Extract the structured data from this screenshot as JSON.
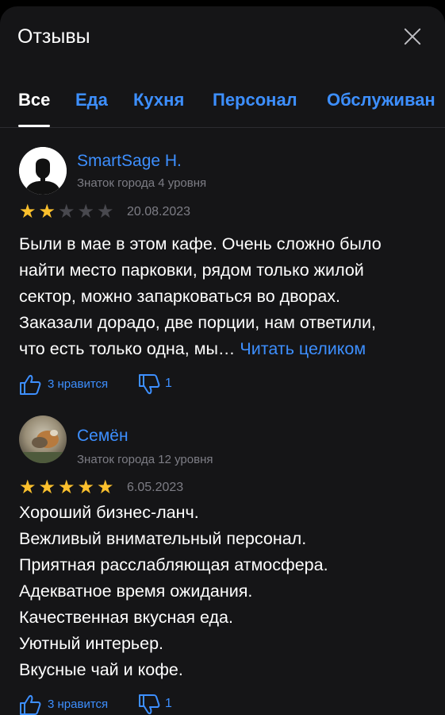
{
  "header": {
    "title": "Отзывы",
    "close_icon": "close-icon"
  },
  "tabs": [
    {
      "label": "Все",
      "active": true
    },
    {
      "label": "Еда",
      "active": false
    },
    {
      "label": "Кухня",
      "active": false
    },
    {
      "label": "Персонал",
      "active": false
    },
    {
      "label": "Обслуживан",
      "active": false
    }
  ],
  "colors": {
    "accent": "#3d8fff",
    "star": "#fbc02d",
    "background": "#151517"
  },
  "reviews": [
    {
      "author": "SmartSage H.",
      "level": "Знаток города 4 уровня",
      "rating": 2,
      "rating_max": 5,
      "date": "20.08.2023",
      "lines": [
        "Были в мае в этом кафе. Очень сложно было",
        "найти место парковки, рядом только жилой",
        "сектор, можно запарковаться во дворах.",
        "Заказали дорадо, две порции, нам ответили,",
        "что есть только одна, мы…"
      ],
      "read_more": "Читать целиком",
      "like_label": "3 нравится",
      "dislike_count": "1",
      "avatar_icon": "user-silhouette-icon"
    },
    {
      "author": "Семён",
      "level": "Знаток города 12 уровня",
      "rating": 5,
      "rating_max": 5,
      "date": "6.05.2023",
      "lines": [
        "Хороший бизнес-ланч.",
        "Вежливый внимательный персонал.",
        "Приятная расслабляющая атмосфера.",
        "Адекватное время ожидания.",
        "Качественная вкусная еда.",
        "Уютный интерьер.",
        "Вкусные чай и кофе."
      ],
      "like_label": "3 нравится",
      "dislike_count": "1",
      "avatar_icon": "photo-avatar"
    }
  ]
}
